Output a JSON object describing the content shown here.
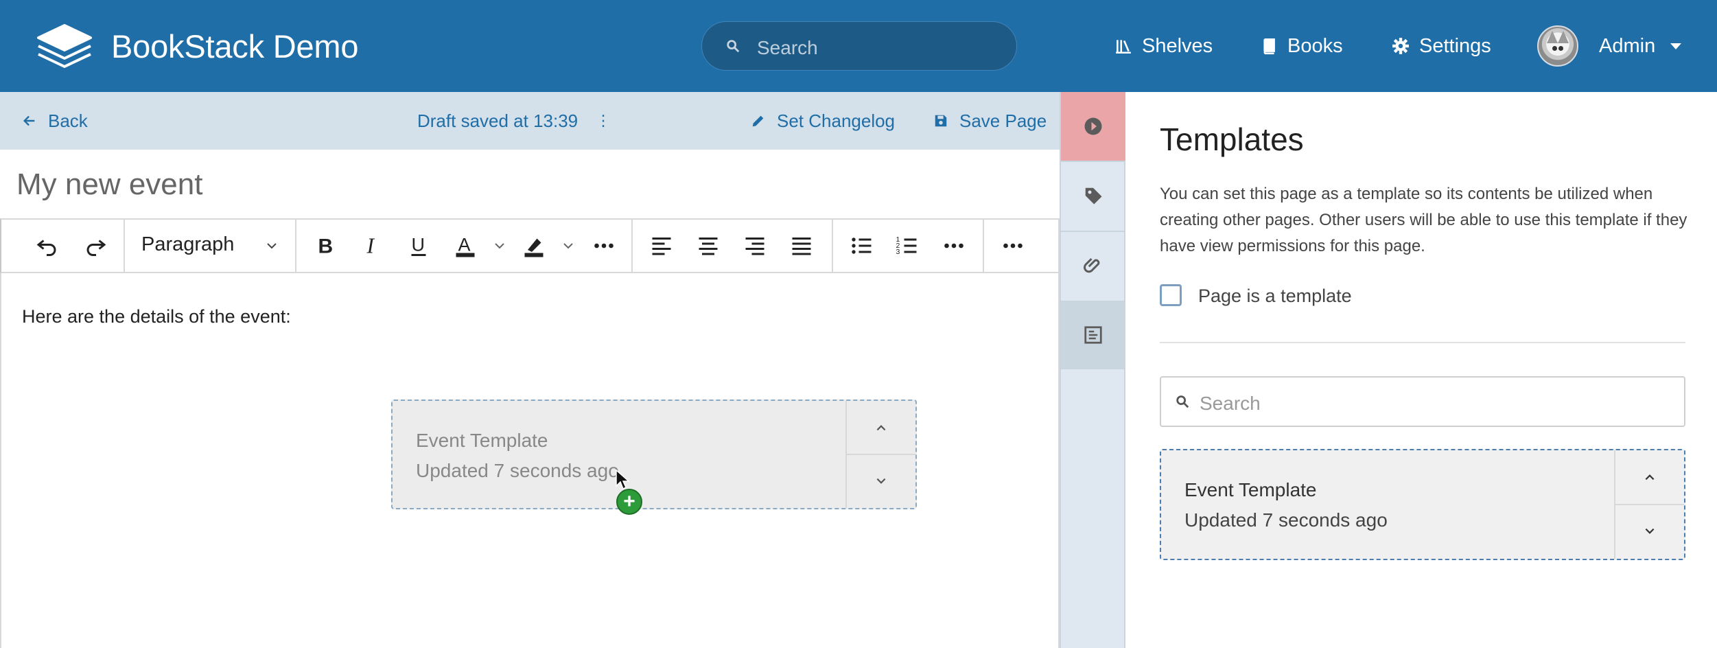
{
  "header": {
    "brand": "BookStack Demo",
    "search_placeholder": "Search",
    "nav": {
      "shelves": "Shelves",
      "books": "Books",
      "settings": "Settings",
      "user": "Admin"
    },
    "colors": {
      "primary": "#206ea7"
    }
  },
  "editor_bar": {
    "back": "Back",
    "draft_status": "Draft saved at 13:39",
    "draft_menu": "⋮",
    "changelog": "Set Changelog",
    "save": "Save Page"
  },
  "page": {
    "title": "My new event",
    "body_text": "Here are the details of the event:"
  },
  "toolbar": {
    "block_format": "Paragraph",
    "icons": [
      "undo-icon",
      "redo-icon",
      "bold-icon",
      "italic-icon",
      "underline-icon",
      "text-color-icon",
      "highlight-icon",
      "more-icon",
      "align-left-icon",
      "align-center-icon",
      "align-right-icon",
      "justify-icon",
      "bullet-list-icon",
      "numbered-list-icon",
      "more-icon",
      "more-icon"
    ]
  },
  "drag_ghost": {
    "name": "Event Template",
    "updated": "Updated 7 seconds ago"
  },
  "side_tabs": [
    "play-icon",
    "tag-icon",
    "attachment-icon",
    "template-icon"
  ],
  "templates_panel": {
    "title": "Templates",
    "description": "You can set this page as a template so its contents be utilized when creating other pages. Other users will be able to use this template if they have view permissions for this page.",
    "checkbox_label": "Page is a template",
    "search_placeholder": "Search",
    "items": [
      {
        "name": "Event Template",
        "updated": "Updated 7 seconds ago"
      }
    ]
  }
}
